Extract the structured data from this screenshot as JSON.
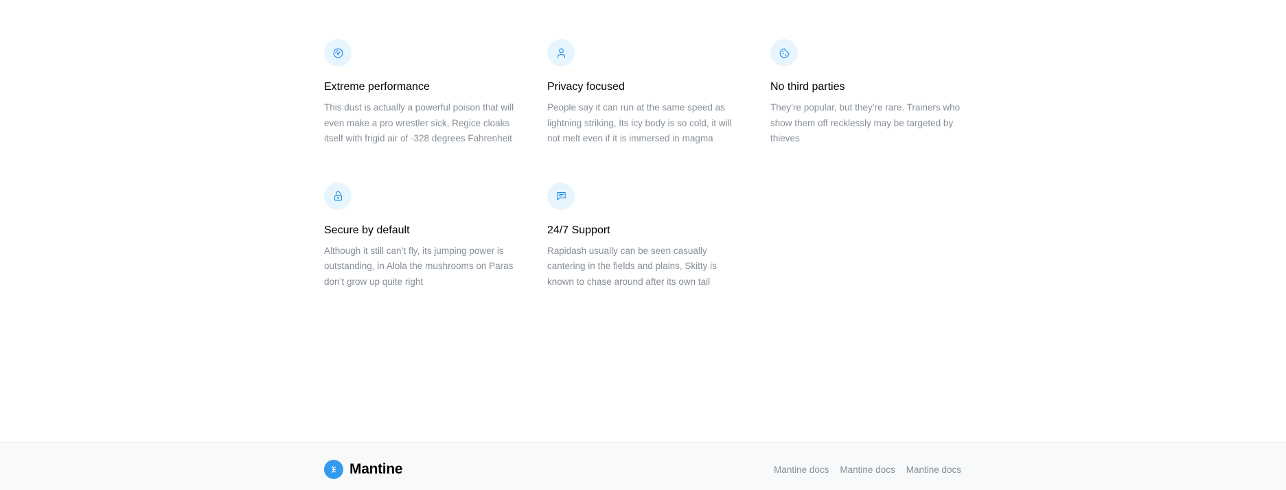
{
  "features": [
    {
      "icon": "gauge-icon",
      "title": "Extreme performance",
      "description": "This dust is actually a powerful poison that will even make a pro wrestler sick, Regice cloaks itself with frigid air of -328 degrees Fahrenheit"
    },
    {
      "icon": "user-icon",
      "title": "Privacy focused",
      "description": "People say it can run at the same speed as lightning striking, Its icy body is so cold, it will not melt even if it is immersed in magma"
    },
    {
      "icon": "cookie-icon",
      "title": "No third parties",
      "description": "They’re popular, but they’re rare. Trainers who show them off recklessly may be targeted by thieves"
    },
    {
      "icon": "lock-icon",
      "title": "Secure by default",
      "description": "Although it still can’t fly, its jumping power is outstanding, in Alola the mushrooms on Paras don’t grow up quite right"
    },
    {
      "icon": "message-icon",
      "title": "24/7 Support",
      "description": "Rapidash usually can be seen casually cantering in the fields and plains, Skitty is known to chase around after its own tail"
    }
  ],
  "footer": {
    "brand": "Mantine",
    "logo_icon": "mantine-logo-icon",
    "links": [
      "Mantine docs",
      "Mantine docs",
      "Mantine docs"
    ]
  },
  "colors": {
    "accent": "#228be6",
    "icon_bg": "#e7f5ff",
    "muted_text": "#868e96",
    "footer_bg": "#f8f9fa"
  }
}
